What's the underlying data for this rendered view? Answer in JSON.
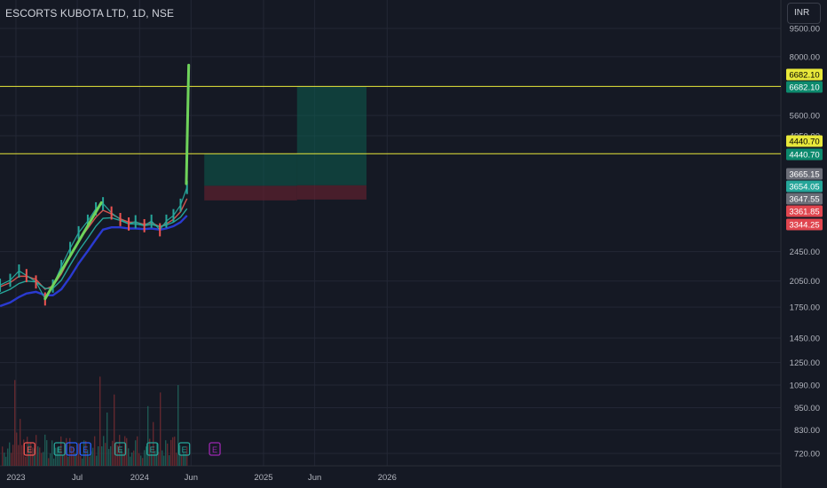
{
  "header": {
    "symbol_title": "ESCORTS KUBOTA LTD, 1D, NSE",
    "currency_button": "INR"
  },
  "colors": {
    "background": "#151924",
    "grid": "#232735",
    "text": "#b2b5be",
    "level_line": "#e8e83a",
    "trend_line": "#6fd35b",
    "candle_up": "#26a69a",
    "candle_down": "#ef5350",
    "ma_fast": "#d6544e",
    "ma_mid": "#26a69a",
    "ma_slow": "#2a3ad0",
    "target_zone": "#0d5c4e",
    "stop_zone": "#6b2131",
    "earnings": "#ef5350",
    "earnings_alt": "#26a69a",
    "dividend": "#2962ff",
    "event_purple": "#9c27b0"
  },
  "chart_data": {
    "type": "line",
    "title": "ESCORTS KUBOTA LTD, 1D, NSE",
    "y_scale": "log",
    "ylim": [
      680,
      10000
    ],
    "x_ticks": [
      "2023",
      "Jul",
      "2024",
      "Jun",
      "2025",
      "Jun",
      "2026"
    ],
    "y_ticks": [
      9500.0,
      8000.0,
      5600.0,
      4950.0,
      2450.0,
      2050.0,
      1750.0,
      1450.0,
      1250.0,
      1090.0,
      950.0,
      830.0,
      720.0
    ],
    "price_labels": [
      {
        "value": "6682.10",
        "color": "#e8e83a",
        "text_color": "#000000"
      },
      {
        "value": "6682.10",
        "color": "#0d8a6e",
        "text_color": "#ffffff"
      },
      {
        "value": "4440.70",
        "color": "#e8e83a",
        "text_color": "#000000"
      },
      {
        "value": "4440.70",
        "color": "#0d8a6e",
        "text_color": "#ffffff"
      },
      {
        "value": "3665.15",
        "color": "#6b6e78",
        "text_color": "#ffffff"
      },
      {
        "value": "3654.05",
        "color": "#26a69a",
        "text_color": "#ffffff"
      },
      {
        "value": "3647.55",
        "color": "#6b6e78",
        "text_color": "#ffffff"
      },
      {
        "value": "3361.85",
        "color": "#e0464f",
        "text_color": "#ffffff"
      },
      {
        "value": "3344.25",
        "color": "#e0464f",
        "text_color": "#ffffff"
      }
    ],
    "horizontal_levels": [
      6682.1,
      4440.7
    ],
    "price_series": {
      "name": "",
      "x": [
        "2022-11-15",
        "2022-12-15",
        "2023-01-10",
        "2023-02-01",
        "2023-03-01",
        "2023-03-28",
        "2023-04-20",
        "2023-05-15",
        "2023-06-10",
        "2023-07-05",
        "2023-08-01",
        "2023-08-25",
        "2023-09-15",
        "2023-10-10",
        "2023-11-05",
        "2023-11-30",
        "2023-12-20",
        "2024-01-15",
        "2024-02-05",
        "2024-03-01",
        "2024-03-20",
        "2024-04-10",
        "2024-05-01",
        "2024-05-20"
      ],
      "y": [
        2000,
        2060,
        2180,
        2120,
        2040,
        1840,
        1990,
        2240,
        2500,
        2750,
        2950,
        3180,
        3280,
        3100,
        2980,
        2900,
        2940,
        2870,
        2950,
        2800,
        2950,
        3050,
        3250,
        3620
      ]
    },
    "moving_averages": [
      {
        "name": "",
        "y": [
          1980,
          2030,
          2110,
          2110,
          2070,
          1950,
          1990,
          2140,
          2380,
          2620,
          2820,
          3020,
          3150,
          3080,
          2990,
          2930,
          2930,
          2890,
          2920,
          2850,
          2900,
          2980,
          3120,
          3380
        ]
      },
      {
        "name": "",
        "y": [
          1900,
          1950,
          2020,
          2050,
          2040,
          1960,
          1960,
          2060,
          2260,
          2460,
          2660,
          2860,
          3000,
          3010,
          2960,
          2900,
          2900,
          2870,
          2890,
          2850,
          2880,
          2930,
          3020,
          3180
        ]
      },
      {
        "name": "",
        "y": [
          1760,
          1800,
          1860,
          1900,
          1920,
          1880,
          1880,
          1950,
          2100,
          2280,
          2460,
          2640,
          2800,
          2840,
          2840,
          2820,
          2820,
          2810,
          2820,
          2800,
          2820,
          2860,
          2930,
          3050
        ]
      }
    ],
    "trend_lines": [
      {
        "x": [
          "2023-03-28",
          "2023-09-10"
        ],
        "y": [
          1840,
          3300
        ]
      },
      {
        "x": [
          "2024-05-18",
          "2024-05-25"
        ],
        "y": [
          3700,
          7600
        ]
      }
    ],
    "position_zones": [
      {
        "type": "target",
        "x": [
          "2024-07-10",
          "2025-04-10"
        ],
        "y": [
          3654.05,
          4440.7
        ]
      },
      {
        "type": "stop",
        "x": [
          "2024-07-10",
          "2025-04-10"
        ],
        "y": [
          3344.25,
          3654.05
        ]
      },
      {
        "type": "target",
        "x": [
          "2025-04-10",
          "2025-11-01"
        ],
        "y": [
          3665.15,
          6682.1
        ]
      },
      {
        "type": "stop",
        "x": [
          "2025-04-10",
          "2025-11-01"
        ],
        "y": [
          3361.85,
          3665.15
        ]
      }
    ],
    "volume_pane": true,
    "event_markers": [
      {
        "type": "E",
        "color": "#ef5350",
        "x": "2023-02-10"
      },
      {
        "type": "E",
        "color": "#26a69a",
        "x": "2023-05-10"
      },
      {
        "type": "D",
        "color": "#2962ff",
        "x": "2023-06-15"
      },
      {
        "type": "E",
        "color": "#2962ff",
        "x": "2023-07-25"
      },
      {
        "type": "E",
        "color": "#26a69a",
        "x": "2023-11-05"
      },
      {
        "type": "E",
        "color": "#26a69a",
        "x": "2024-02-08"
      },
      {
        "type": "E",
        "color": "#26a69a",
        "x": "2024-05-12"
      },
      {
        "type": "E",
        "color": "#9c27b0",
        "x": "2024-08-10"
      }
    ],
    "grid": true
  }
}
